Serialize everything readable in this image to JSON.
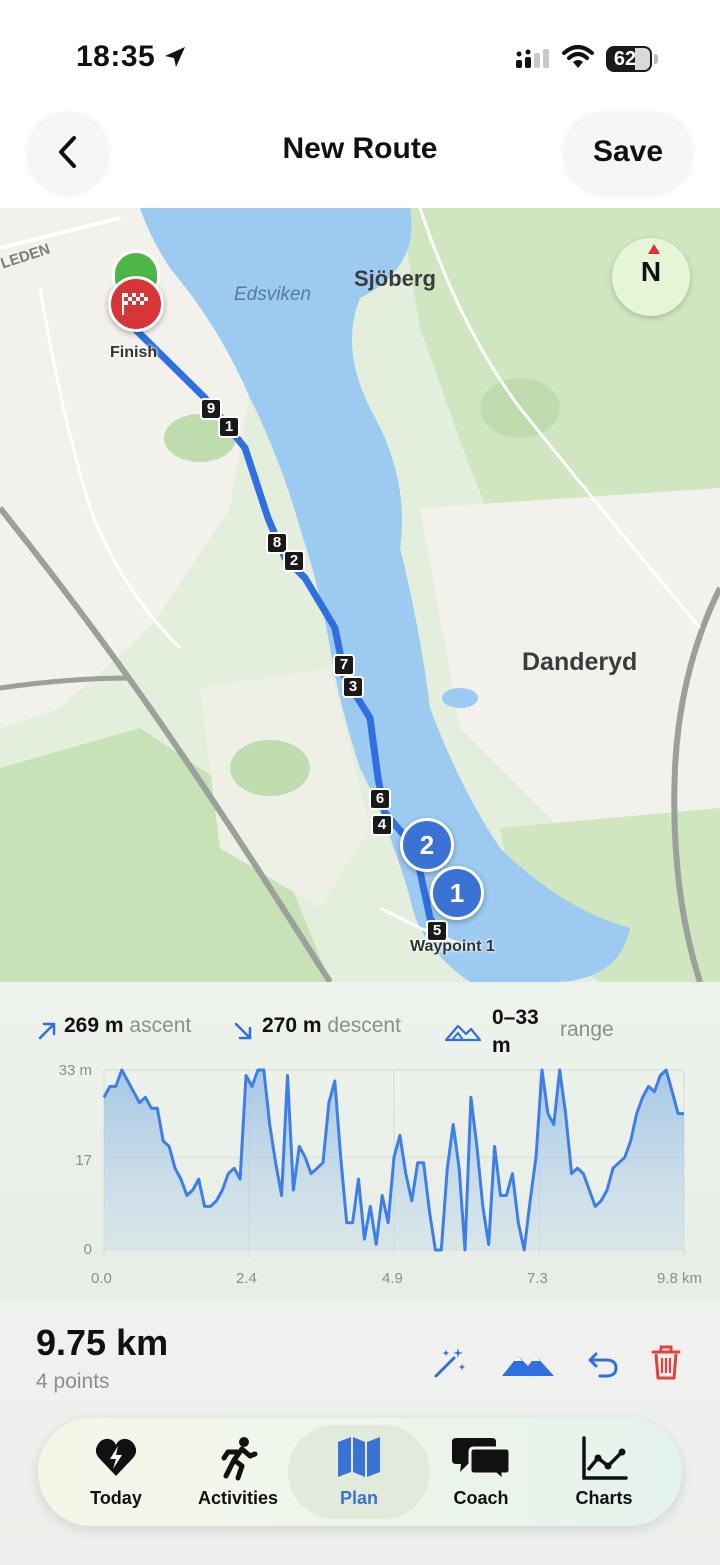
{
  "status_bar": {
    "time": "18:35",
    "battery": "62",
    "icons": [
      "location-arrow-icon",
      "cellular-signal-icon",
      "wifi-icon",
      "battery-icon"
    ]
  },
  "header": {
    "title": "New Route",
    "save_label": "Save",
    "back_icon": "chevron-left-icon"
  },
  "map": {
    "place_labels": {
      "sjoberg": "Sjöberg",
      "danderyd": "Danderyd",
      "edsviken": "Edsviken",
      "road": "LEDEN"
    },
    "compass_label": "N",
    "finish_label": "Finish",
    "waypoint_label": "Waypoint 1",
    "waypoints": [
      "1",
      "2"
    ],
    "km_markers": [
      "9",
      "1",
      "8",
      "2",
      "7",
      "3",
      "6",
      "4",
      "5"
    ],
    "colors": {
      "route": "#2f6fe0",
      "water": "#9ccaf0",
      "land": "#dfeeda",
      "waypoint": "#3b73d4",
      "finish": "#d63637"
    }
  },
  "elevation": {
    "ascent_value": "269 m",
    "ascent_label": "ascent",
    "descent_value": "270 m",
    "descent_label": "descent",
    "range_value": "0–33 m",
    "range_label": "range",
    "y_ticks": [
      "33 m",
      "17",
      "0"
    ],
    "x_ticks": [
      "0.0",
      "2.4",
      "4.9",
      "7.3",
      "9.8 km"
    ]
  },
  "chart_data": {
    "type": "area",
    "xlabel": "",
    "ylabel": "",
    "xlim": [
      0,
      9.8
    ],
    "ylim": [
      0,
      33
    ],
    "x": [
      0,
      0.1,
      0.2,
      0.3,
      0.4,
      0.5,
      0.6,
      0.7,
      0.8,
      0.9,
      1.0,
      1.1,
      1.2,
      1.3,
      1.4,
      1.5,
      1.6,
      1.7,
      1.8,
      1.9,
      2.0,
      2.1,
      2.2,
      2.3,
      2.4,
      2.5,
      2.6,
      2.7,
      2.8,
      2.9,
      3.0,
      3.1,
      3.2,
      3.3,
      3.4,
      3.5,
      3.6,
      3.7,
      3.8,
      3.9,
      4.0,
      4.1,
      4.2,
      4.3,
      4.4,
      4.5,
      4.6,
      4.7,
      4.8,
      4.9,
      5.0,
      5.1,
      5.2,
      5.3,
      5.4,
      5.5,
      5.6,
      5.7,
      5.8,
      5.9,
      6.0,
      6.1,
      6.2,
      6.3,
      6.4,
      6.5,
      6.6,
      6.7,
      6.8,
      6.9,
      7.0,
      7.1,
      7.2,
      7.3,
      7.4,
      7.5,
      7.6,
      7.7,
      7.8,
      7.9,
      8.0,
      8.1,
      8.2,
      8.3,
      8.4,
      8.5,
      8.6,
      8.7,
      8.8,
      8.9,
      9.0,
      9.1,
      9.2,
      9.3,
      9.4,
      9.5,
      9.6,
      9.7,
      9.8
    ],
    "values": [
      28,
      30,
      30,
      33,
      31,
      29,
      27,
      28,
      26,
      26,
      20,
      19,
      15,
      13,
      10,
      11,
      13,
      8,
      8,
      9,
      11,
      14,
      15,
      13,
      32,
      30,
      33,
      33,
      23,
      16,
      10,
      32,
      11,
      19,
      17,
      14,
      15,
      16,
      27,
      31,
      17,
      5,
      5,
      13,
      2,
      8,
      1,
      10,
      5,
      17,
      21,
      14,
      9,
      16,
      16,
      7,
      0,
      0,
      15,
      23,
      15,
      0,
      28,
      19,
      8,
      1,
      19,
      10,
      10,
      14,
      5,
      0,
      9,
      17,
      33,
      25,
      23,
      33,
      25,
      14,
      15,
      14,
      11,
      8,
      9,
      11,
      15,
      16,
      17,
      20,
      25,
      28,
      30,
      29,
      32,
      33,
      29,
      25,
      25
    ]
  },
  "summary": {
    "distance": "9.75 km",
    "points": "4 points",
    "tools": [
      "magic-wand-icon",
      "elevation-icon",
      "undo-icon",
      "trash-icon"
    ]
  },
  "tabs": [
    {
      "label": "Today",
      "icon": "heart-bolt-icon"
    },
    {
      "label": "Activities",
      "icon": "running-figure-icon"
    },
    {
      "label": "Plan",
      "icon": "map-icon"
    },
    {
      "label": "Coach",
      "icon": "chat-bubbles-icon"
    },
    {
      "label": "Charts",
      "icon": "line-chart-icon"
    }
  ]
}
